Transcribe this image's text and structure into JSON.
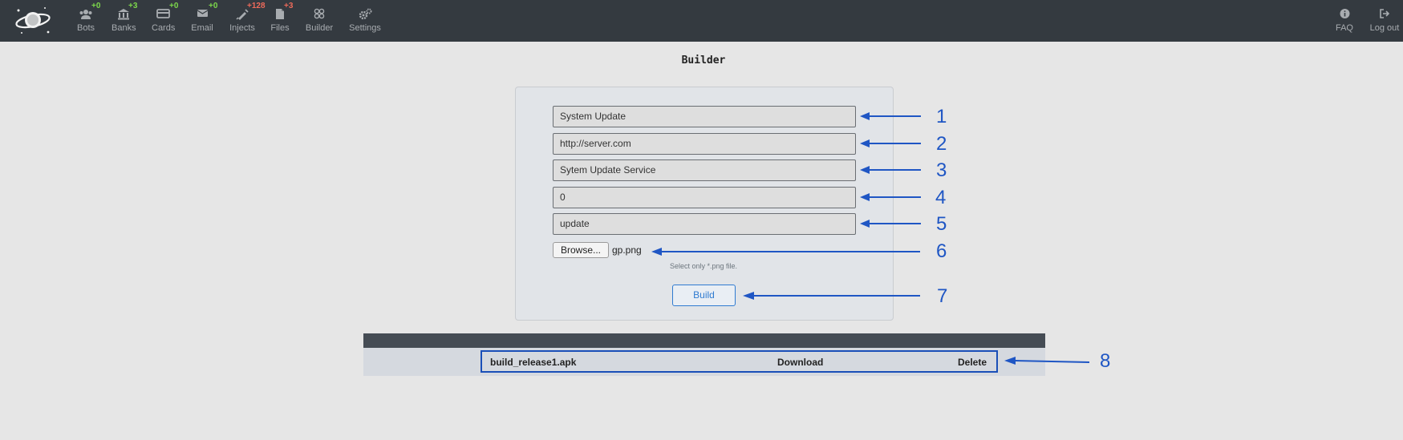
{
  "nav": {
    "items": [
      {
        "label": "Bots",
        "badge": "+0",
        "badge_color": "green",
        "icon": "users-icon"
      },
      {
        "label": "Banks",
        "badge": "+3",
        "badge_color": "green",
        "icon": "bank-icon"
      },
      {
        "label": "Cards",
        "badge": "+0",
        "badge_color": "green",
        "icon": "credit-card-icon"
      },
      {
        "label": "Email",
        "badge": "+0",
        "badge_color": "green",
        "icon": "envelope-icon"
      },
      {
        "label": "Injects",
        "badge": "+128",
        "badge_color": "red",
        "icon": "syringe-icon"
      },
      {
        "label": "Files",
        "badge": "+3",
        "badge_color": "red",
        "icon": "file-icon"
      },
      {
        "label": "Builder",
        "badge": "",
        "badge_color": "",
        "icon": "builder-icon"
      },
      {
        "label": "Settings",
        "badge": "",
        "badge_color": "",
        "icon": "cogs-icon"
      }
    ],
    "right": [
      {
        "label": "FAQ",
        "icon": "info-circle-icon"
      },
      {
        "label": "Log out",
        "icon": "sign-out-icon"
      }
    ]
  },
  "page": {
    "title": "Builder"
  },
  "form": {
    "app_name": "System Update",
    "server_url": "http://server.com",
    "service_name": "Sytem Update Service",
    "delay": "0",
    "tag": "update",
    "browse_label": "Browse...",
    "file_name": "gp.png",
    "file_hint": "Select only *.png file.",
    "build_label": "Build"
  },
  "builds": {
    "rows": [
      {
        "file": "build_release1.apk",
        "download": "Download",
        "delete": "Delete"
      }
    ]
  },
  "annotations": [
    "1",
    "2",
    "3",
    "4",
    "5",
    "6",
    "7",
    "8"
  ],
  "colors": {
    "topbar": "#343a40",
    "badge_green": "#7cd84b",
    "badge_red": "#ee6a5a",
    "accent": "#2f7bd1",
    "annotation": "#1f56c4"
  }
}
